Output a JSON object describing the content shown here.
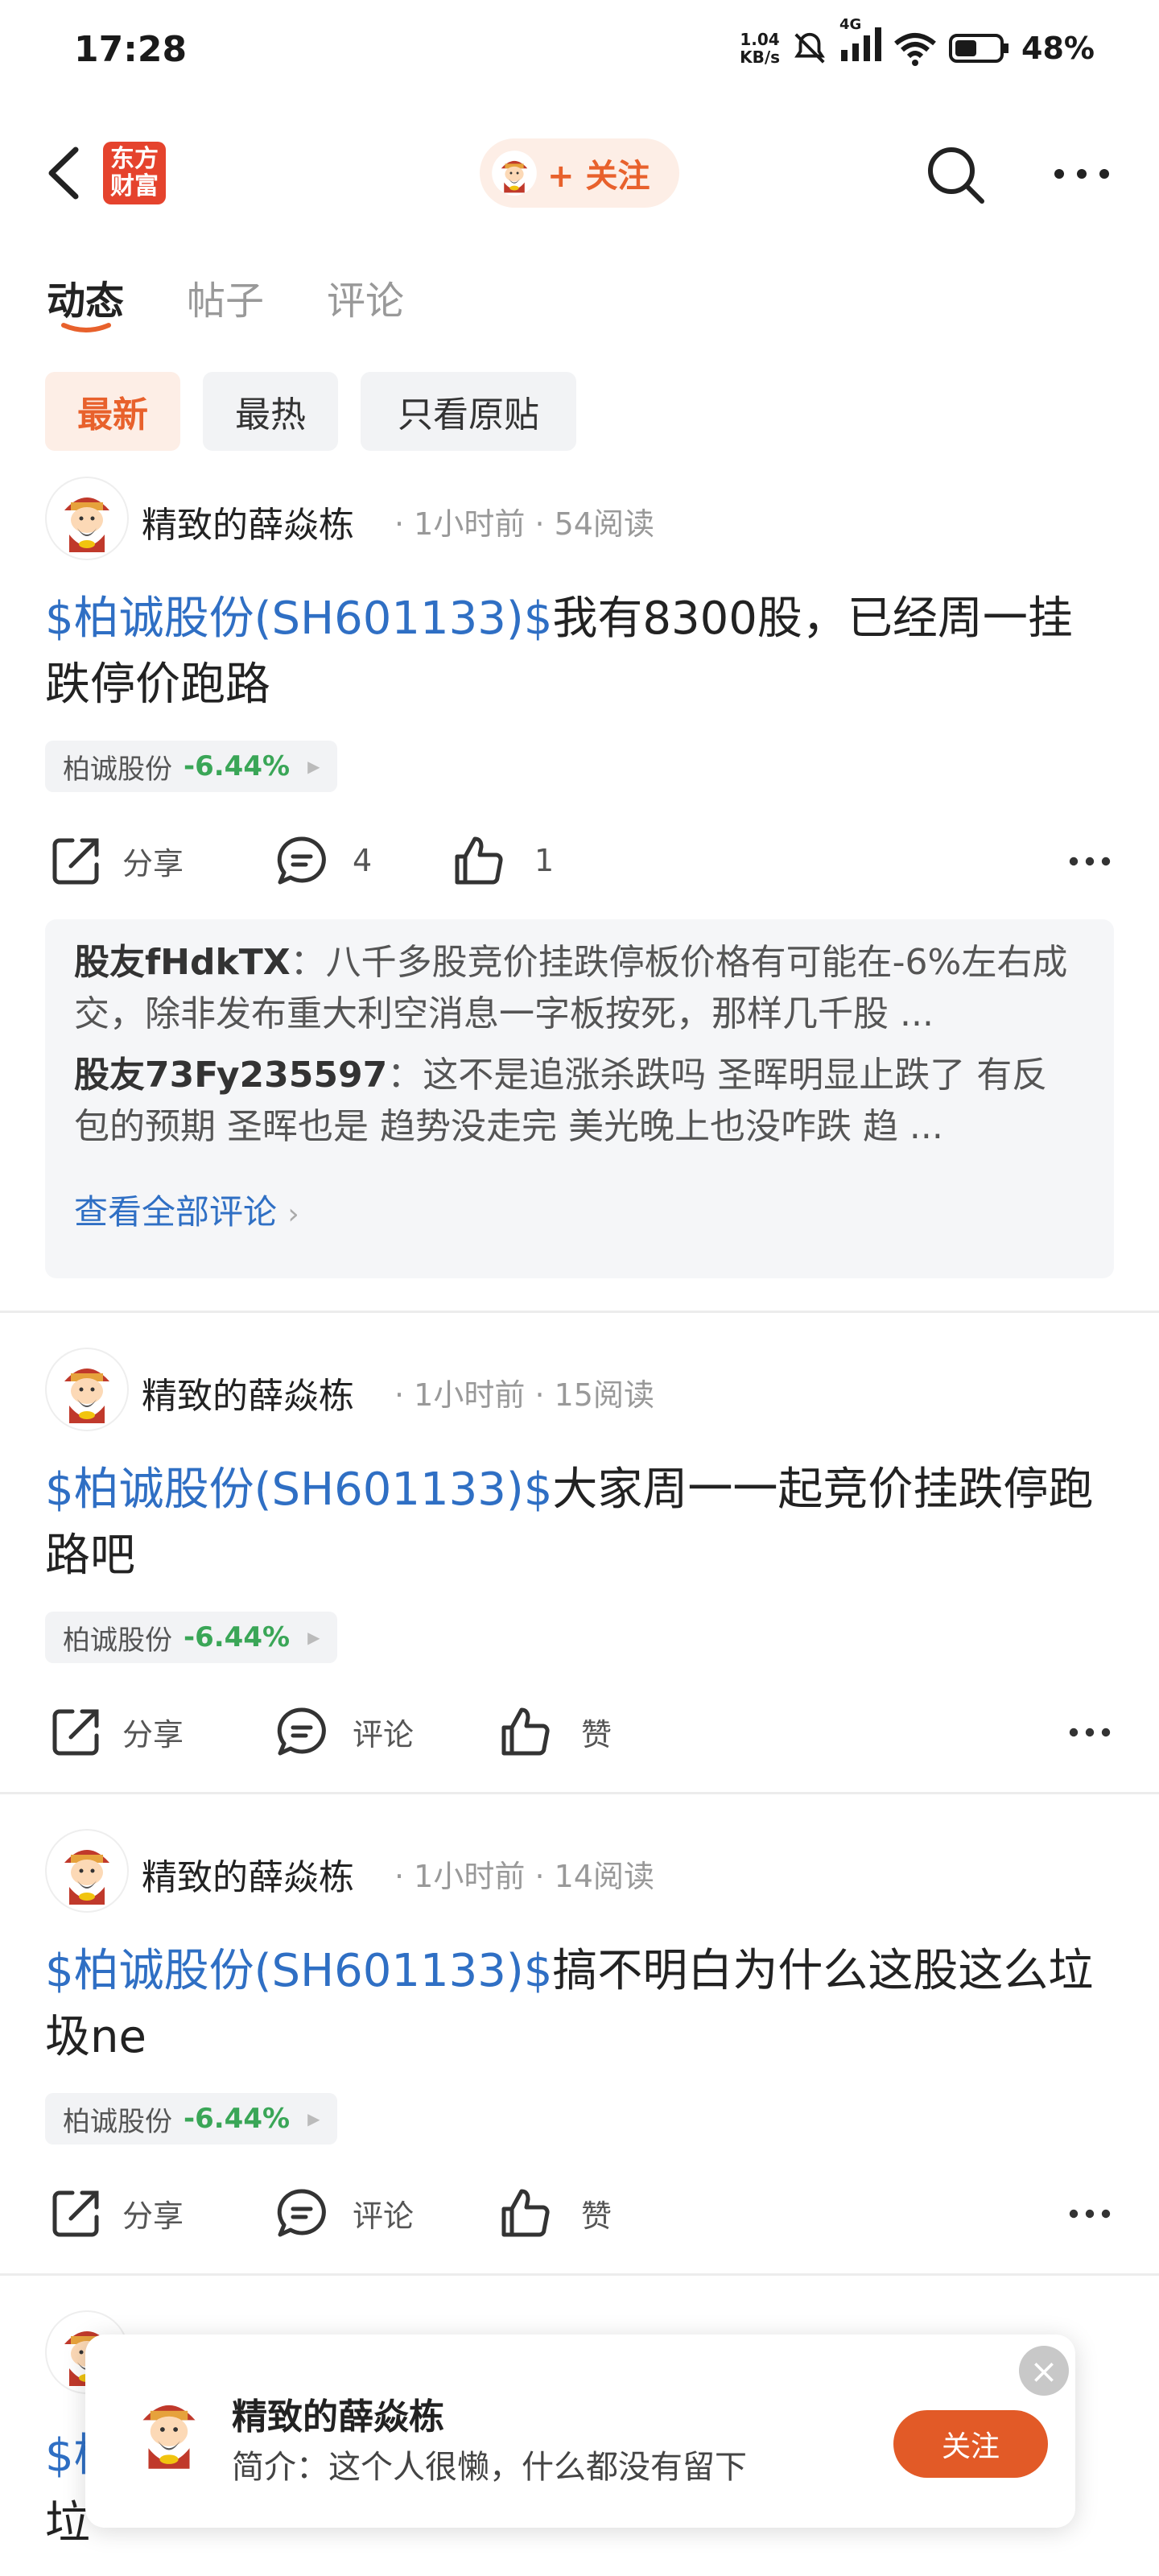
{
  "status_bar": {
    "time": "17:28",
    "net_speed_value": "1.04",
    "net_speed_unit": "KB/s",
    "network": "4G",
    "battery": "48%"
  },
  "header": {
    "logo_line1": "东方",
    "logo_line2": "财富",
    "follow_label": "+ 关注"
  },
  "tabs": [
    {
      "label": "动态"
    },
    {
      "label": "帖子"
    },
    {
      "label": "评论"
    }
  ],
  "filters": [
    {
      "label": "最新"
    },
    {
      "label": "最热"
    },
    {
      "label": "只看原贴"
    }
  ],
  "posts": [
    {
      "author": "精致的薛焱栋",
      "time": "1小时前",
      "reads": "54阅读",
      "stock_link": "$柏诚股份(SH601133)$",
      "text": "我有8300股，已经周一挂跌停价跑路",
      "stock_tag": {
        "name": "柏诚股份",
        "change": "-6.44%"
      },
      "share_label": "分享",
      "comment_label": "4",
      "like_label": "1",
      "comments": [
        {
          "user": "股友fHdkTX",
          "text": "八千多股竞价挂跌停板价格有可能在-6%左右成交，除非发布重大利空消息一字板按死，那样几千股 ..."
        },
        {
          "user": "股友73Fy235597",
          "text": "这不是追涨杀跌吗 圣晖明显止跌了 有反包的预期 圣晖也是 趋势没走完 美光晚上也没咋跌 趋 ..."
        }
      ],
      "see_all": "查看全部评论"
    },
    {
      "author": "精致的薛焱栋",
      "time": "1小时前",
      "reads": "15阅读",
      "stock_link": "$柏诚股份(SH601133)$",
      "text": "大家周一一起竞价挂跌停跑路吧",
      "stock_tag": {
        "name": "柏诚股份",
        "change": "-6.44%"
      },
      "share_label": "分享",
      "comment_label": "评论",
      "like_label": "赞"
    },
    {
      "author": "精致的薛焱栋",
      "time": "1小时前",
      "reads": "14阅读",
      "stock_link": "$柏诚股份(SH601133)$",
      "text": "搞不明白为什么这股这么垃圾ne",
      "stock_tag": {
        "name": "柏诚股份",
        "change": "-6.44%"
      },
      "share_label": "分享",
      "comment_label": "评论",
      "like_label": "赞"
    }
  ],
  "partial_post": {
    "link_fragment": "$柏",
    "text_fragment": "垃"
  },
  "popup": {
    "name": "精致的薛焱栋",
    "bio": "简介：这个人很懒，什么都没有留下",
    "follow_label": "关注",
    "close_glyph": "×"
  },
  "colors": {
    "brand": "#e8612c",
    "link": "#2f6fc4",
    "down": "#3aa657"
  }
}
